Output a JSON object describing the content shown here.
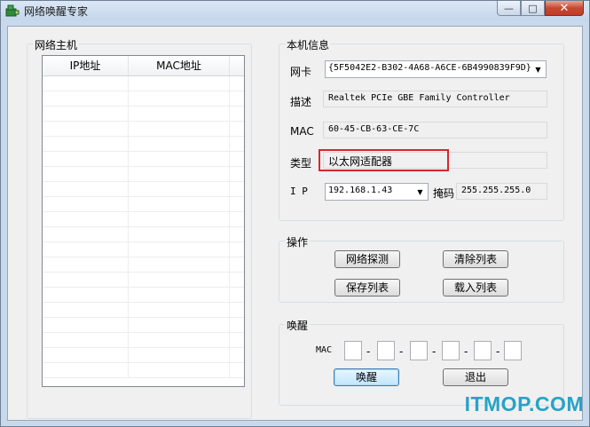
{
  "window": {
    "title": "网络唤醒专家"
  },
  "hosts_group": {
    "label": "网络主机",
    "columns": [
      "IP地址",
      "MAC地址"
    ]
  },
  "info_group": {
    "label": "本机信息",
    "nic_label": "网卡",
    "nic_value": "{5F5042E2-B302-4A68-A6CE-6B4990839F9D}",
    "desc_label": "描述",
    "desc_value": "Realtek PCIe GBE Family Controller",
    "mac_label": "MAC",
    "mac_value": "60-45-CB-63-CE-7C",
    "type_label": "类型",
    "type_value": "以太网适配器",
    "ip_label": "I P",
    "ip_value": "192.168.1.43",
    "mask_label": "掩码",
    "mask_value": "255.255.255.0"
  },
  "ops_group": {
    "label": "操作",
    "detect": "网络探测",
    "clear": "清除列表",
    "save": "保存列表",
    "load": "载入列表"
  },
  "wake_group": {
    "label": "唤醒",
    "mac_label": "MAC",
    "mac_sep": "-",
    "wake": "唤醒",
    "exit": "退出"
  },
  "watermark": "ITMOP.COM",
  "colors": {
    "highlight": "#d9262c",
    "watermark": "#26a3c6"
  }
}
